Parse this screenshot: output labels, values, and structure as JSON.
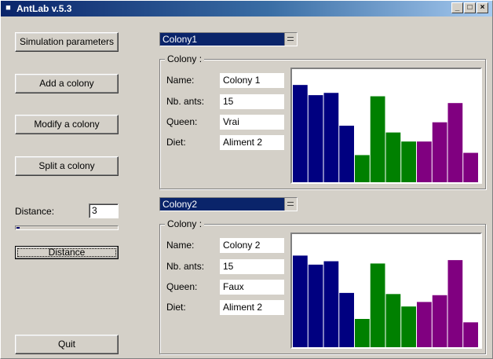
{
  "window": {
    "title": "AntLab v.5.3",
    "buttons": {
      "minimize": "_",
      "maximize": "□",
      "close": "×"
    }
  },
  "left_panel": {
    "simulation_parameters": "Simulation parameters",
    "add_colony": "Add a colony",
    "modify_colony": "Modify a colony",
    "split_colony": "Split a colony",
    "distance_label": "Distance:",
    "distance_value": "3",
    "slider_level": 0.03,
    "distance_button": "Distance",
    "quit": "Quit"
  },
  "colonies": [
    {
      "selector": "Colony1",
      "group_title": "Colony :",
      "labels": {
        "name": "Name:",
        "ants": "Nb. ants:",
        "queen": "Queen:",
        "diet": "Diet:"
      },
      "name": "Colony 1",
      "ants": "15",
      "queen": "Vrai",
      "diet": "Aliment 2"
    },
    {
      "selector": "Colony2",
      "group_title": "Colony :",
      "labels": {
        "name": "Name:",
        "ants": "Nb. ants:",
        "queen": "Queen:",
        "diet": "Diet:"
      },
      "name": "Colony 2",
      "ants": "15",
      "queen": "Faux",
      "diet": "Aliment 2"
    }
  ],
  "colors": {
    "blue": "#000080",
    "green": "#008000",
    "purple": "#800080"
  },
  "chart_data": [
    {
      "type": "bar",
      "ylim": [
        0,
        100
      ],
      "series": [
        {
          "color": "blue",
          "values": [
            86,
            77,
            79,
            50
          ]
        },
        {
          "color": "green",
          "values": [
            24,
            76,
            44,
            36
          ]
        },
        {
          "color": "purple",
          "values": [
            36,
            53,
            70,
            26
          ]
        }
      ]
    },
    {
      "type": "bar",
      "ylim": [
        0,
        100
      ],
      "series": [
        {
          "color": "blue",
          "values": [
            81,
            73,
            76,
            48
          ]
        },
        {
          "color": "green",
          "values": [
            25,
            74,
            47,
            36
          ]
        },
        {
          "color": "purple",
          "values": [
            40,
            46,
            77,
            22
          ]
        }
      ]
    }
  ]
}
